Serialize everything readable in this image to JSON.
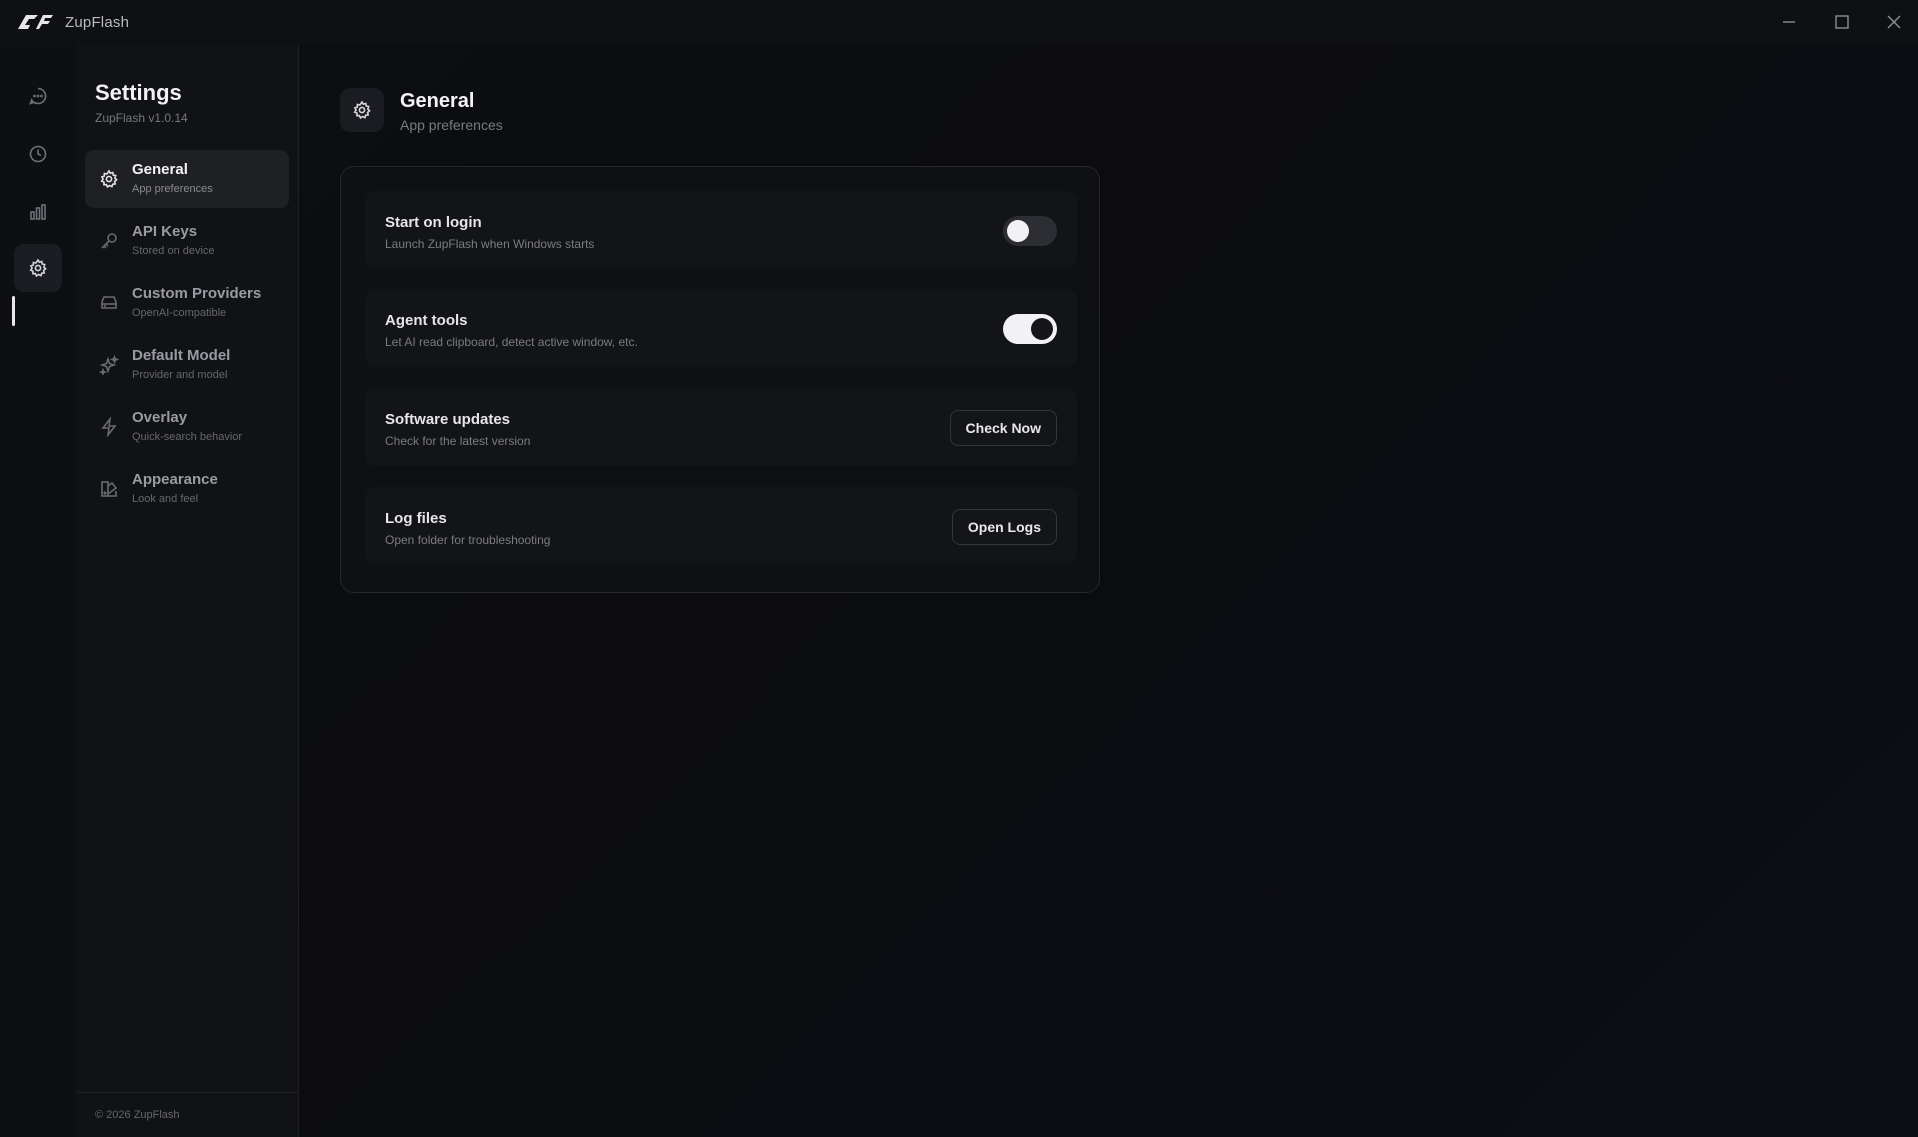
{
  "window": {
    "title": "ZupFlash"
  },
  "rail": {
    "items": [
      {
        "name": "chat",
        "icon": "chat-icon"
      },
      {
        "name": "history",
        "icon": "clock-icon"
      },
      {
        "name": "analytics",
        "icon": "bar-chart-icon"
      },
      {
        "name": "settings",
        "icon": "gear-icon",
        "active": true
      }
    ]
  },
  "sidebar": {
    "title": "Settings",
    "version": "ZupFlash v1.0.14",
    "items": [
      {
        "label": "General",
        "sub": "App preferences",
        "icon": "gear-icon",
        "active": true
      },
      {
        "label": "API Keys",
        "sub": "Stored on device",
        "icon": "key-icon"
      },
      {
        "label": "Custom Providers",
        "sub": "OpenAI-compatible",
        "icon": "server-icon"
      },
      {
        "label": "Default Model",
        "sub": "Provider and model",
        "icon": "sparkle-icon"
      },
      {
        "label": "Overlay",
        "sub": "Quick-search behavior",
        "icon": "lightning-icon"
      },
      {
        "label": "Appearance",
        "sub": "Look and feel",
        "icon": "palette-icon"
      }
    ],
    "footer": "© 2026 ZupFlash"
  },
  "main": {
    "title": "General",
    "subtitle": "App preferences",
    "rows": [
      {
        "label": "Start on login",
        "sub": "Launch ZupFlash when Windows starts",
        "control": "toggle",
        "on": false
      },
      {
        "label": "Agent tools",
        "sub": "Let AI read clipboard, detect active window, etc.",
        "control": "toggle",
        "on": true
      },
      {
        "label": "Software updates",
        "sub": "Check for the latest version",
        "control": "button",
        "button_label": "Check Now"
      },
      {
        "label": "Log files",
        "sub": "Open folder for troubleshooting",
        "control": "button",
        "button_label": "Open Logs"
      }
    ]
  },
  "colors": {
    "background": "#0c0d10",
    "accent": "#f2f2f4",
    "muted_text": "#7b7c83"
  }
}
